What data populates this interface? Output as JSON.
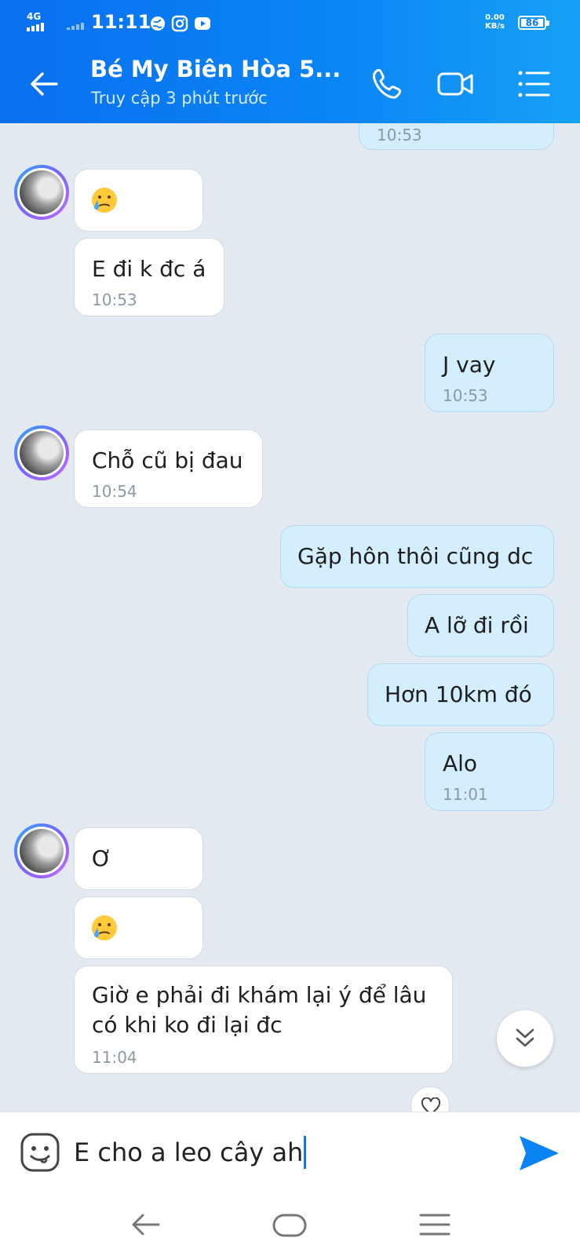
{
  "status_bar": {
    "network": "4G",
    "time": "11:11",
    "speed_value": "0.00",
    "speed_unit": "KB/s",
    "battery": "86"
  },
  "header": {
    "contact_name": "Bé My Biên Hòa 5...",
    "last_seen": "Truy cập 3 phút trước",
    "icons": [
      "back-arrow-icon",
      "phone-icon",
      "video-call-icon",
      "menu-list-icon"
    ]
  },
  "messages": [
    {
      "side": "out",
      "text": "",
      "time": "10:53"
    },
    {
      "side": "in",
      "emoji": "sad-tear-face",
      "text": "",
      "time": ""
    },
    {
      "side": "in",
      "text": "E đi k đc á",
      "time": "10:53"
    },
    {
      "side": "out",
      "text": "J vay",
      "time": "10:53"
    },
    {
      "side": "in",
      "text": "Chỗ cũ bị đau",
      "time": "10:54"
    },
    {
      "side": "out",
      "text": "Gặp hôn thôi cũng dc",
      "time": ""
    },
    {
      "side": "out",
      "text": "A lỡ đi rồi",
      "time": ""
    },
    {
      "side": "out",
      "text": "Hơn 10km đó",
      "time": ""
    },
    {
      "side": "out",
      "text": "Alo",
      "time": "11:01"
    },
    {
      "side": "in",
      "text": "Ơ",
      "time": ""
    },
    {
      "side": "in",
      "emoji": "sad-tear-face",
      "text": "",
      "time": ""
    },
    {
      "side": "in",
      "text_line1": "Giờ e phải đi khám lại ý để lâu",
      "text_line2": "có khi ko đi lại đc",
      "time": "11:04"
    }
  ],
  "composer": {
    "value": "E cho a leo cây ah",
    "icons": [
      "sticker-face-icon",
      "send-icon"
    ]
  },
  "colors": {
    "header_gradient_start": "#0a6ff0",
    "header_gradient_end": "#17a0f7",
    "chat_background": "#e2e9f1",
    "incoming_bubble": "#ffffff",
    "outgoing_bubble": "#d3eefe",
    "send_button": "#0a84f5"
  }
}
